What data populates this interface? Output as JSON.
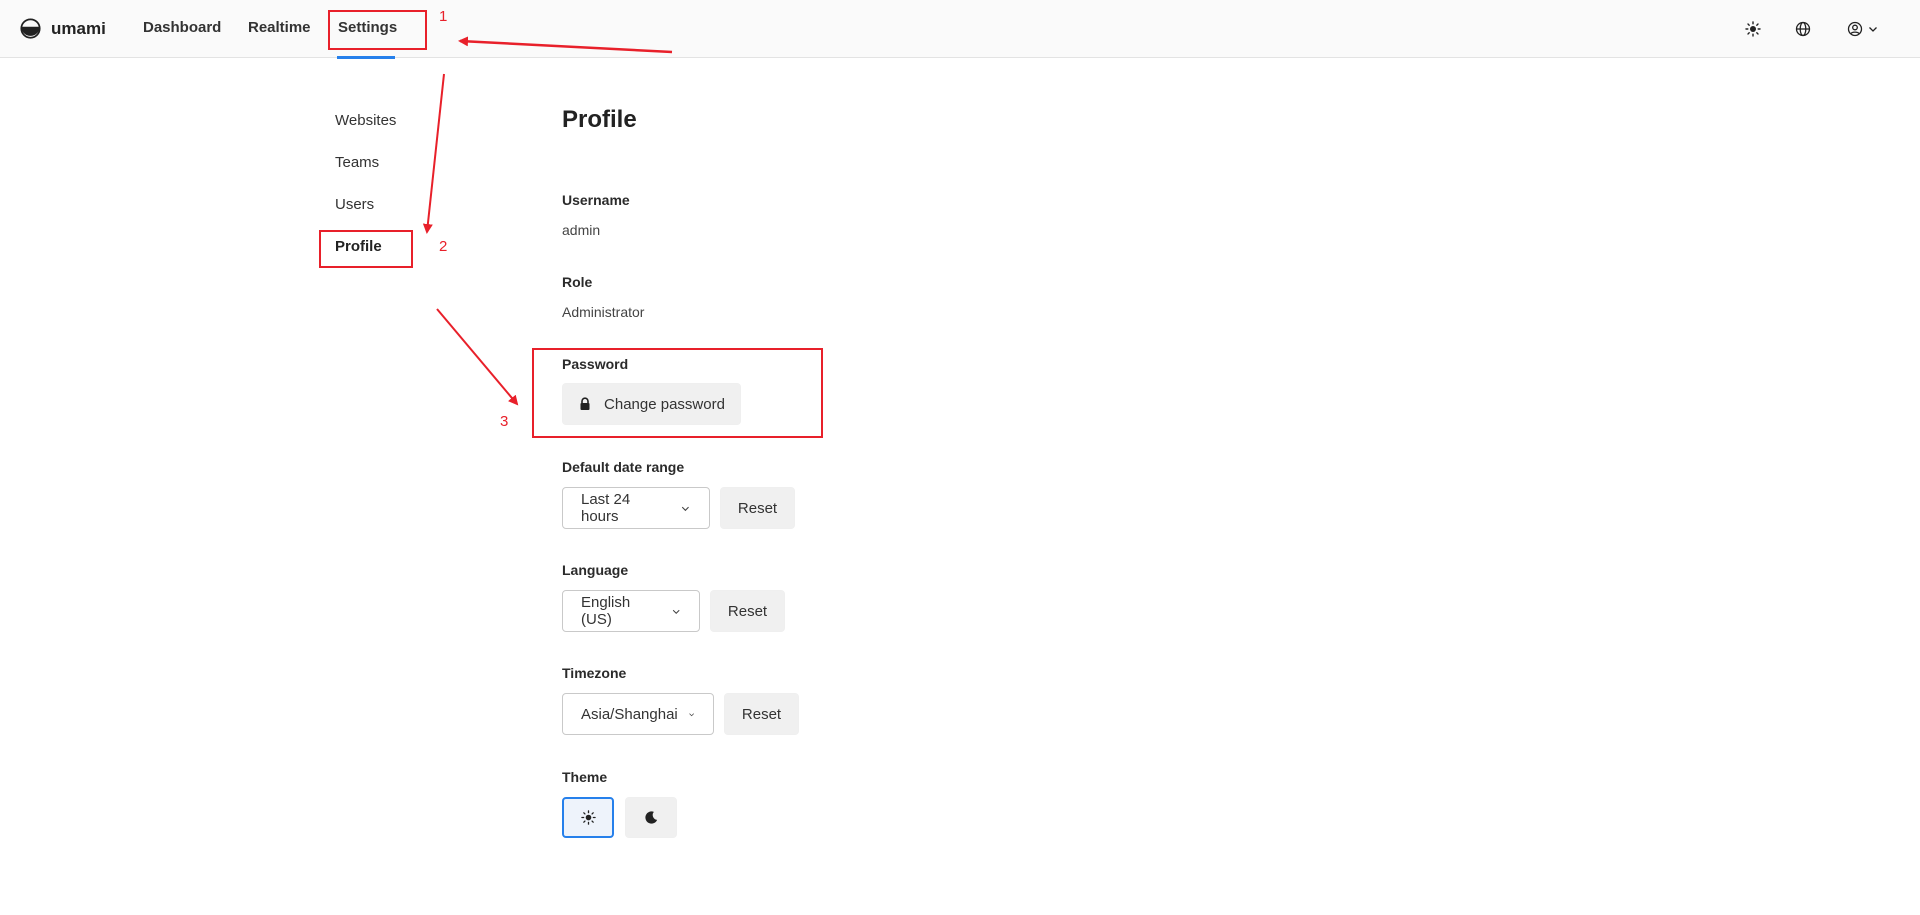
{
  "header": {
    "app_name": "umami",
    "nav": {
      "dashboard": "Dashboard",
      "realtime": "Realtime",
      "settings": "Settings"
    },
    "icons": [
      "sun-icon",
      "globe-icon",
      "user-circle-icon",
      "chevron-down-icon"
    ]
  },
  "sidebar": {
    "items": [
      {
        "label": "Websites"
      },
      {
        "label": "Teams"
      },
      {
        "label": "Users"
      },
      {
        "label": "Profile",
        "active": true
      }
    ]
  },
  "profile": {
    "title": "Profile",
    "username_label": "Username",
    "username_value": "admin",
    "role_label": "Role",
    "role_value": "Administrator",
    "password_label": "Password",
    "change_password_label": "Change password",
    "date_range_label": "Default date range",
    "date_range_value": "Last 24 hours",
    "language_label": "Language",
    "language_value": "English (US)",
    "timezone_label": "Timezone",
    "timezone_value": "Asia/Shanghai",
    "reset_label": "Reset",
    "theme_label": "Theme",
    "theme_selected": "light"
  },
  "annotations": {
    "step_1": "1",
    "step_2": "2",
    "step_3": "3",
    "color": "#e8202a"
  },
  "colors": {
    "accent": "#2680eb",
    "header_bg": "#fafafa",
    "button_bg": "#f0f0f0"
  }
}
